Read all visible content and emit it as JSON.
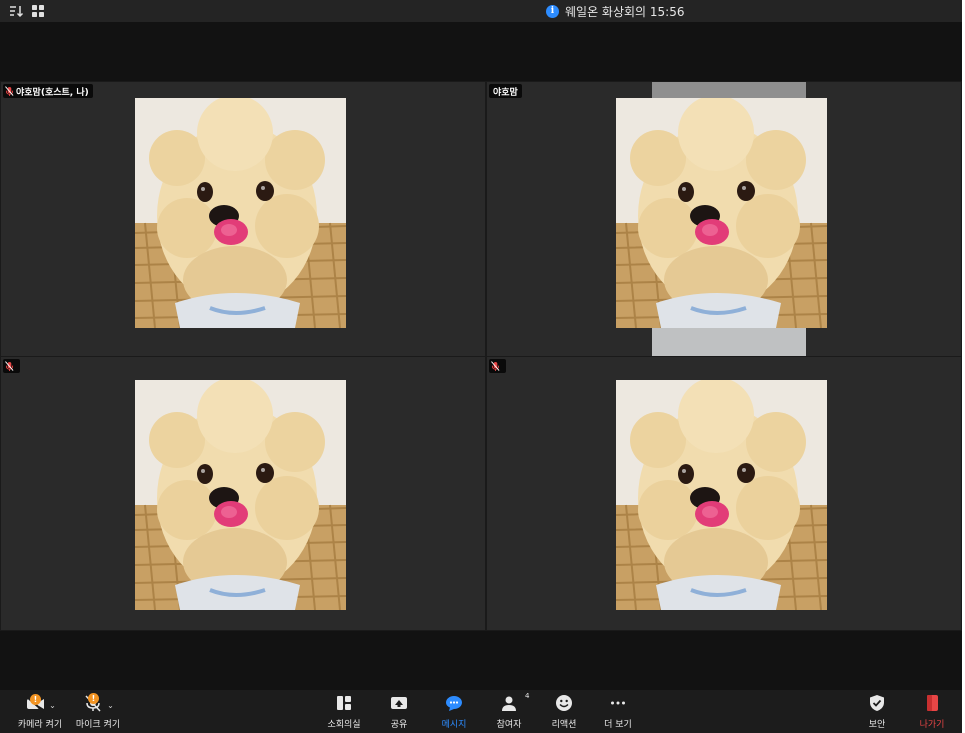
{
  "window": {
    "title": "웨일온 화상회의 15:56"
  },
  "icons": {
    "sort": "sort-icon",
    "gallery": "gallery-view-icon",
    "info": "info-icon",
    "muted_mic": "muted-mic-icon"
  },
  "colors": {
    "accent": "#2d8cff",
    "warning": "#f29423",
    "danger": "#e84646",
    "tile_bg": "#2a2a2a"
  },
  "participants": [
    {
      "name": "야호맘(호스트, 나)",
      "muted": true
    },
    {
      "name": "야호맘",
      "muted": false
    },
    {
      "name": "",
      "muted": true
    },
    {
      "name": "",
      "muted": true
    }
  ],
  "toolbar": {
    "camera": {
      "label": "카메라 켜기",
      "alert": "!"
    },
    "mic": {
      "label": "마이크 켜기",
      "alert": "!"
    },
    "breakout": {
      "label": "소회의실"
    },
    "share": {
      "label": "공유"
    },
    "chat": {
      "label": "메시지"
    },
    "participants": {
      "label": "참여자",
      "count": "4"
    },
    "reactions": {
      "label": "리액션"
    },
    "more": {
      "label": "더 보기"
    },
    "security": {
      "label": "보안"
    },
    "leave": {
      "label": "나가기"
    }
  }
}
